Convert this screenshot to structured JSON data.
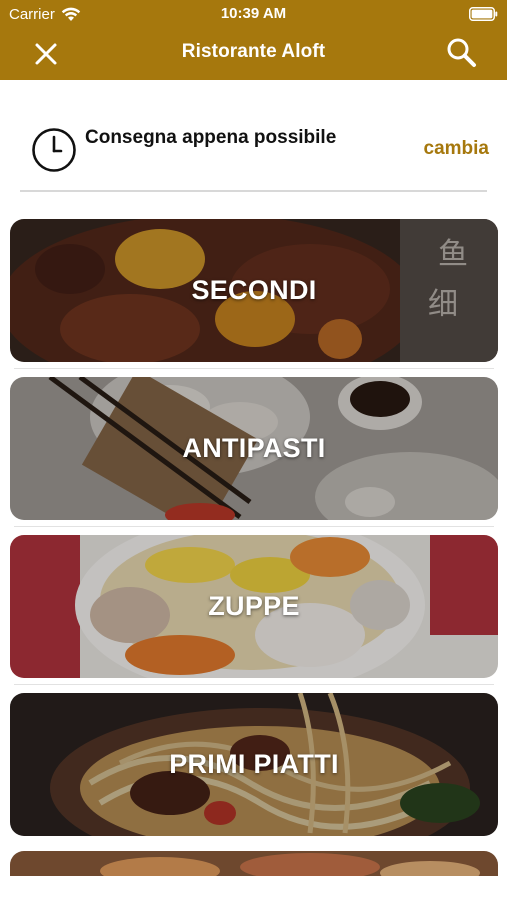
{
  "status_bar": {
    "carrier": "Carrier",
    "time": "10:39 AM"
  },
  "nav": {
    "title": "Ristorante Aloft",
    "close_icon": "close-icon",
    "search_icon": "search-icon"
  },
  "delivery": {
    "text": "Consegna appena possibile",
    "change_label": "cambia",
    "icon": "clock-icon"
  },
  "categories": [
    {
      "label": "SECONDI"
    },
    {
      "label": "ANTIPASTI"
    },
    {
      "label": "ZUPPE"
    },
    {
      "label": "PRIMI PIATTI"
    }
  ],
  "colors": {
    "accent": "#a6780d",
    "header_text": "#ffffff",
    "divider": "#d8d8d8"
  }
}
